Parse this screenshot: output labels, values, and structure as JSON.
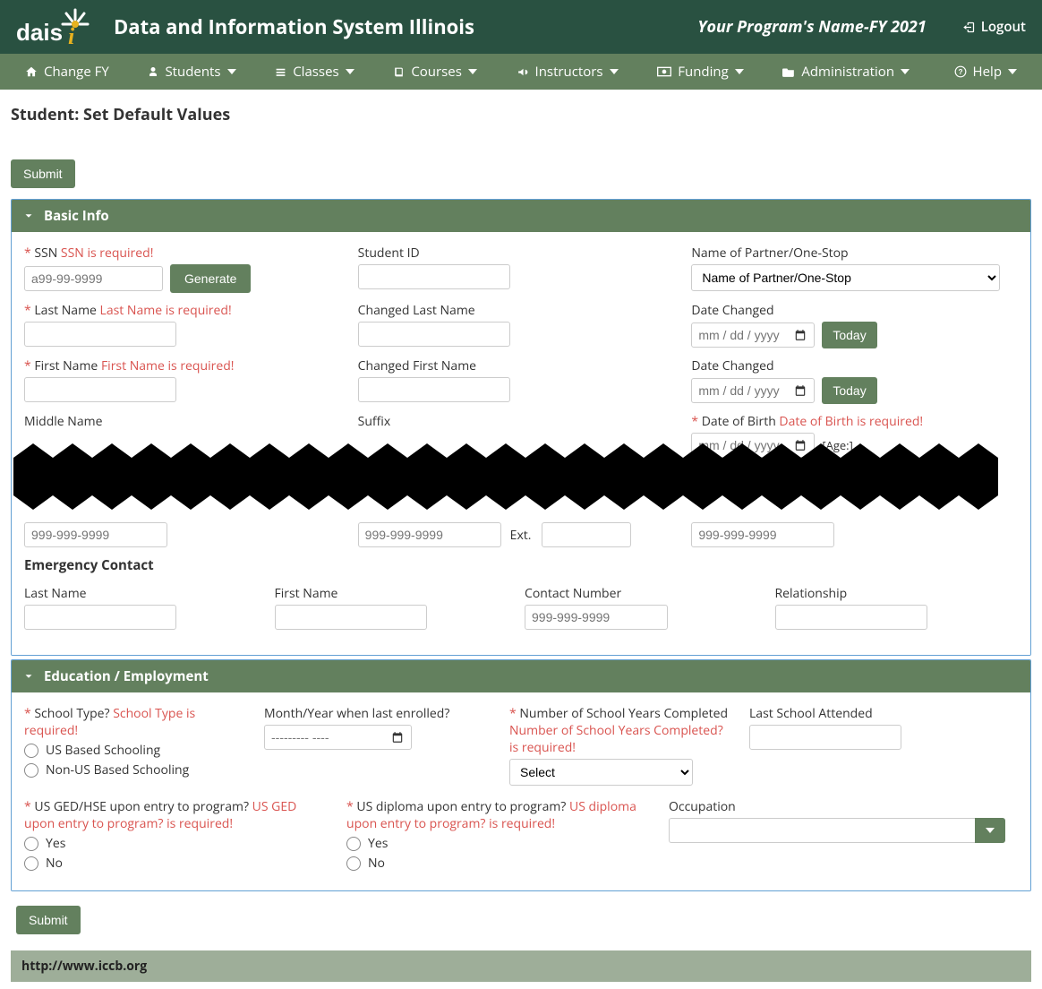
{
  "header": {
    "brand": "Data and Information System Illinois",
    "program": "Your Program's Name-FY 2021",
    "logout": "Logout"
  },
  "nav": {
    "change_fy": "Change FY",
    "students": "Students",
    "classes": "Classes",
    "courses": "Courses",
    "instructors": "Instructors",
    "funding": "Funding",
    "administration": "Administration",
    "help": "Help"
  },
  "page_title": "Student: Set Default Values",
  "buttons": {
    "submit": "Submit",
    "generate": "Generate",
    "today": "Today"
  },
  "panels": {
    "basic_info": "Basic Info",
    "education": "Education / Employment"
  },
  "basic": {
    "ssn_label": "SSN",
    "ssn_err": "SSN is required!",
    "ssn_placeholder": "a99-99-9999",
    "student_id_label": "Student ID",
    "partner_label": "Name of Partner/One-Stop",
    "partner_option": "Name of Partner/One-Stop",
    "last_name_label": "Last Name",
    "last_name_err": "Last Name is required!",
    "changed_last_label": "Changed Last Name",
    "date_changed_label": "Date Changed",
    "date_placeholder": "mm / dd / yyyy",
    "first_name_label": "First Name",
    "first_name_err": "First Name is required!",
    "changed_first_label": "Changed First Name",
    "middle_label": "Middle Name",
    "suffix_label": "Suffix",
    "dob_label": "Date of Birth",
    "dob_err": "Date of Birth is required!",
    "age_note": "[Age:]",
    "phone_placeholder": "999-999-9999",
    "ext_label": "Ext.",
    "emergency_title": "Emergency Contact",
    "ec_last": "Last Name",
    "ec_first": "First Name",
    "ec_contact": "Contact Number",
    "ec_relationship": "Relationship"
  },
  "edu": {
    "school_type_label": "School Type?",
    "school_type_err": "School Type is required!",
    "school_us": "US Based Schooling",
    "school_non_us": "Non-US Based Schooling",
    "month_year_label": "Month/Year when last enrolled?",
    "month_year_value": "--------- ----",
    "years_label": "Number of School Years Completed",
    "years_err": "Number of School Years Completed? is required!",
    "years_select": "Select",
    "last_school_label": "Last School Attended",
    "ged_label": "US GED/HSE upon entry to program?",
    "ged_err": "US GED upon entry to program? is required!",
    "diploma_label": "US diploma upon entry to program?",
    "diploma_err": "US diploma upon entry to program? is required!",
    "yes": "Yes",
    "no": "No",
    "occupation_label": "Occupation"
  },
  "footer": {
    "url": "http://www.iccb.org"
  }
}
